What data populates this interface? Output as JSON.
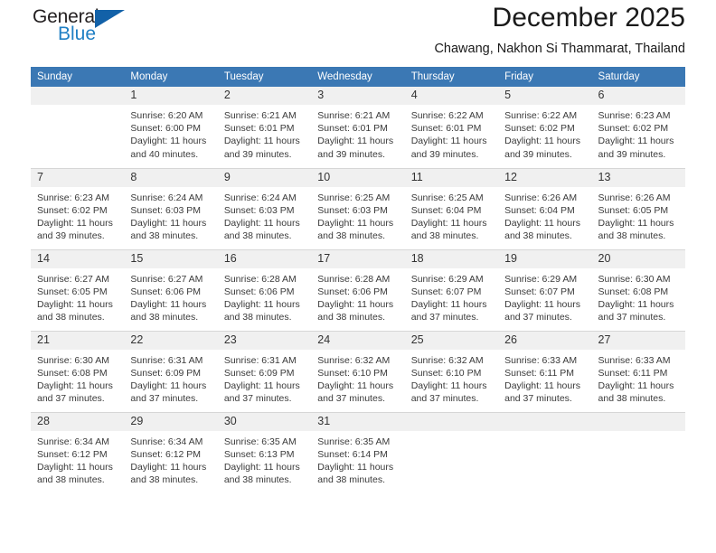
{
  "brand": {
    "name_part1": "General",
    "name_part2": "Blue"
  },
  "header": {
    "title": "December 2025",
    "subtitle": "Chawang, Nakhon Si Thammarat, Thailand"
  },
  "weekdays": [
    "Sunday",
    "Monday",
    "Tuesday",
    "Wednesday",
    "Thursday",
    "Friday",
    "Saturday"
  ],
  "colors": {
    "header_band": "#3b78b4",
    "daynum_band": "#f0f0f0",
    "brand_blue": "#1f7fc4",
    "logo_triangle": "#1261a8",
    "grid_line": "#d6d6d6"
  },
  "weeks": [
    [
      {
        "day": "",
        "empty": true
      },
      {
        "day": "1",
        "sunrise": "Sunrise: 6:20 AM",
        "sunset": "Sunset: 6:00 PM",
        "daylight": "Daylight: 11 hours and 40 minutes."
      },
      {
        "day": "2",
        "sunrise": "Sunrise: 6:21 AM",
        "sunset": "Sunset: 6:01 PM",
        "daylight": "Daylight: 11 hours and 39 minutes."
      },
      {
        "day": "3",
        "sunrise": "Sunrise: 6:21 AM",
        "sunset": "Sunset: 6:01 PM",
        "daylight": "Daylight: 11 hours and 39 minutes."
      },
      {
        "day": "4",
        "sunrise": "Sunrise: 6:22 AM",
        "sunset": "Sunset: 6:01 PM",
        "daylight": "Daylight: 11 hours and 39 minutes."
      },
      {
        "day": "5",
        "sunrise": "Sunrise: 6:22 AM",
        "sunset": "Sunset: 6:02 PM",
        "daylight": "Daylight: 11 hours and 39 minutes."
      },
      {
        "day": "6",
        "sunrise": "Sunrise: 6:23 AM",
        "sunset": "Sunset: 6:02 PM",
        "daylight": "Daylight: 11 hours and 39 minutes."
      }
    ],
    [
      {
        "day": "7",
        "sunrise": "Sunrise: 6:23 AM",
        "sunset": "Sunset: 6:02 PM",
        "daylight": "Daylight: 11 hours and 39 minutes."
      },
      {
        "day": "8",
        "sunrise": "Sunrise: 6:24 AM",
        "sunset": "Sunset: 6:03 PM",
        "daylight": "Daylight: 11 hours and 38 minutes."
      },
      {
        "day": "9",
        "sunrise": "Sunrise: 6:24 AM",
        "sunset": "Sunset: 6:03 PM",
        "daylight": "Daylight: 11 hours and 38 minutes."
      },
      {
        "day": "10",
        "sunrise": "Sunrise: 6:25 AM",
        "sunset": "Sunset: 6:03 PM",
        "daylight": "Daylight: 11 hours and 38 minutes."
      },
      {
        "day": "11",
        "sunrise": "Sunrise: 6:25 AM",
        "sunset": "Sunset: 6:04 PM",
        "daylight": "Daylight: 11 hours and 38 minutes."
      },
      {
        "day": "12",
        "sunrise": "Sunrise: 6:26 AM",
        "sunset": "Sunset: 6:04 PM",
        "daylight": "Daylight: 11 hours and 38 minutes."
      },
      {
        "day": "13",
        "sunrise": "Sunrise: 6:26 AM",
        "sunset": "Sunset: 6:05 PM",
        "daylight": "Daylight: 11 hours and 38 minutes."
      }
    ],
    [
      {
        "day": "14",
        "sunrise": "Sunrise: 6:27 AM",
        "sunset": "Sunset: 6:05 PM",
        "daylight": "Daylight: 11 hours and 38 minutes."
      },
      {
        "day": "15",
        "sunrise": "Sunrise: 6:27 AM",
        "sunset": "Sunset: 6:06 PM",
        "daylight": "Daylight: 11 hours and 38 minutes."
      },
      {
        "day": "16",
        "sunrise": "Sunrise: 6:28 AM",
        "sunset": "Sunset: 6:06 PM",
        "daylight": "Daylight: 11 hours and 38 minutes."
      },
      {
        "day": "17",
        "sunrise": "Sunrise: 6:28 AM",
        "sunset": "Sunset: 6:06 PM",
        "daylight": "Daylight: 11 hours and 38 minutes."
      },
      {
        "day": "18",
        "sunrise": "Sunrise: 6:29 AM",
        "sunset": "Sunset: 6:07 PM",
        "daylight": "Daylight: 11 hours and 37 minutes."
      },
      {
        "day": "19",
        "sunrise": "Sunrise: 6:29 AM",
        "sunset": "Sunset: 6:07 PM",
        "daylight": "Daylight: 11 hours and 37 minutes."
      },
      {
        "day": "20",
        "sunrise": "Sunrise: 6:30 AM",
        "sunset": "Sunset: 6:08 PM",
        "daylight": "Daylight: 11 hours and 37 minutes."
      }
    ],
    [
      {
        "day": "21",
        "sunrise": "Sunrise: 6:30 AM",
        "sunset": "Sunset: 6:08 PM",
        "daylight": "Daylight: 11 hours and 37 minutes."
      },
      {
        "day": "22",
        "sunrise": "Sunrise: 6:31 AM",
        "sunset": "Sunset: 6:09 PM",
        "daylight": "Daylight: 11 hours and 37 minutes."
      },
      {
        "day": "23",
        "sunrise": "Sunrise: 6:31 AM",
        "sunset": "Sunset: 6:09 PM",
        "daylight": "Daylight: 11 hours and 37 minutes."
      },
      {
        "day": "24",
        "sunrise": "Sunrise: 6:32 AM",
        "sunset": "Sunset: 6:10 PM",
        "daylight": "Daylight: 11 hours and 37 minutes."
      },
      {
        "day": "25",
        "sunrise": "Sunrise: 6:32 AM",
        "sunset": "Sunset: 6:10 PM",
        "daylight": "Daylight: 11 hours and 37 minutes."
      },
      {
        "day": "26",
        "sunrise": "Sunrise: 6:33 AM",
        "sunset": "Sunset: 6:11 PM",
        "daylight": "Daylight: 11 hours and 37 minutes."
      },
      {
        "day": "27",
        "sunrise": "Sunrise: 6:33 AM",
        "sunset": "Sunset: 6:11 PM",
        "daylight": "Daylight: 11 hours and 38 minutes."
      }
    ],
    [
      {
        "day": "28",
        "sunrise": "Sunrise: 6:34 AM",
        "sunset": "Sunset: 6:12 PM",
        "daylight": "Daylight: 11 hours and 38 minutes."
      },
      {
        "day": "29",
        "sunrise": "Sunrise: 6:34 AM",
        "sunset": "Sunset: 6:12 PM",
        "daylight": "Daylight: 11 hours and 38 minutes."
      },
      {
        "day": "30",
        "sunrise": "Sunrise: 6:35 AM",
        "sunset": "Sunset: 6:13 PM",
        "daylight": "Daylight: 11 hours and 38 minutes."
      },
      {
        "day": "31",
        "sunrise": "Sunrise: 6:35 AM",
        "sunset": "Sunset: 6:14 PM",
        "daylight": "Daylight: 11 hours and 38 minutes."
      },
      {
        "day": "",
        "empty": true
      },
      {
        "day": "",
        "empty": true
      },
      {
        "day": "",
        "empty": true
      }
    ]
  ]
}
